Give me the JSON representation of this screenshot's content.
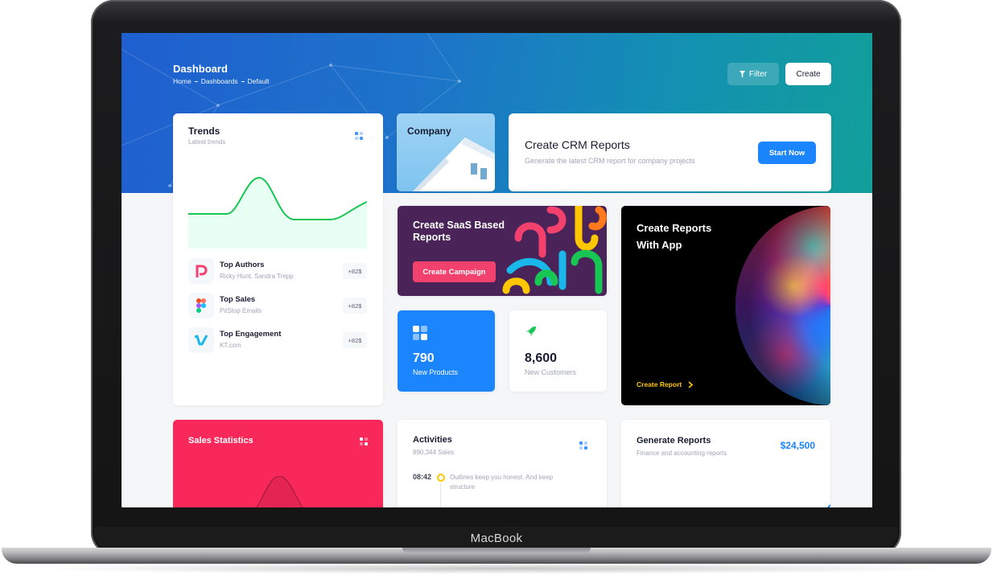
{
  "device": {
    "brand_label": "MacBook"
  },
  "header": {
    "title": "Dashboard",
    "breadcrumb": [
      "Home",
      "Dashboards",
      "Default"
    ],
    "filter_label": "Filter",
    "create_label": "Create"
  },
  "trends": {
    "title": "Trends",
    "subtitle": "Latest trends",
    "items": [
      {
        "name": "Top Authors",
        "desc": "Ricky Hunt, Sandra Trepp",
        "badge": "+82$",
        "icon": "pitstop-logo-icon"
      },
      {
        "name": "Top Sales",
        "desc": "PitStop Emails",
        "badge": "+82$",
        "icon": "figma-logo-icon"
      },
      {
        "name": "Top Engagement",
        "desc": "KT.com",
        "badge": "+82$",
        "icon": "vimeo-logo-icon"
      }
    ]
  },
  "company": {
    "label": "Company"
  },
  "crm": {
    "title": "Create CRM Reports",
    "subtitle": "Generate the latest CRM report for company projects",
    "button": "Start Now"
  },
  "saas": {
    "title": "Create SaaS Based Reports",
    "button": "Create Campaign"
  },
  "stats": [
    {
      "value": "790",
      "label": "New Products",
      "icon": "grid-icon"
    },
    {
      "value": "8,600",
      "label": "New Customers",
      "icon": "rocket-icon"
    }
  ],
  "app_reports": {
    "title": "Create Reports With App",
    "link": "Create Report"
  },
  "sales": {
    "title": "Sales Statistics"
  },
  "activities": {
    "title": "Activities",
    "subtitle": "890,344 Sales",
    "items": [
      {
        "time": "08:42",
        "text": "Outlines keep you honest. And keep structure"
      }
    ]
  },
  "generate": {
    "title": "Generate Reports",
    "subtitle": "Finance and accounting reports",
    "amount": "$24,500"
  },
  "colors": {
    "primary": "#1b84ff",
    "danger": "#f8285a",
    "warning": "#ffc700",
    "success": "#17c653",
    "dark_text": "#181c32",
    "muted_text": "#a1a5b7"
  }
}
